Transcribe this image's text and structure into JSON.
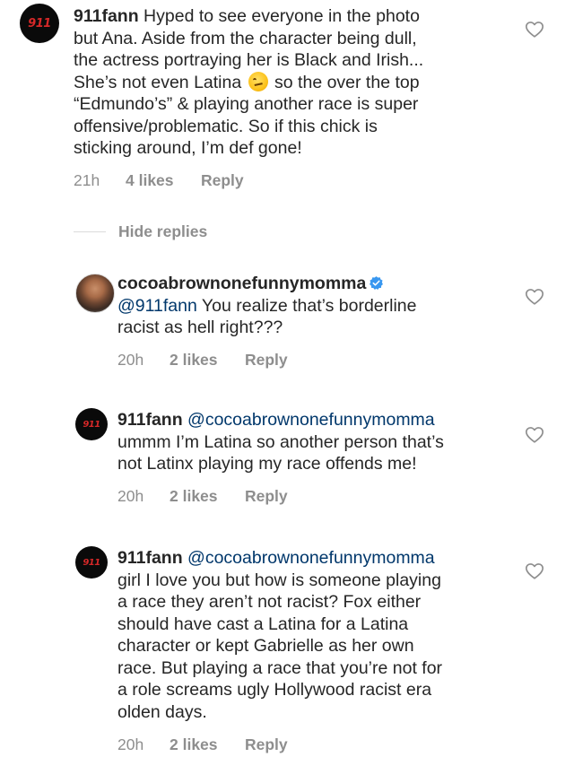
{
  "comments": [
    {
      "avatar_text": "911",
      "username": "911fann",
      "lines": [
        "Hyped to see everyone in the photo",
        "but Ana. Aside from the character being dull,",
        "the actress portraying her is Black and Irish...",
        "She’s not even Latina",
        "so the over the top",
        "“Edmundo’s” & playing another race is super",
        "offensive/problematic. So if this chick is",
        "sticking around, I’m def gone!"
      ],
      "emoji": "smirking-face-emoji",
      "time": "21h",
      "likes": "4 likes",
      "reply": "Reply"
    },
    {
      "username": "cocoabrownonefunnymomma",
      "verified": true,
      "mention": "@911fann",
      "lines": [
        "You realize that’s borderline",
        "racist as hell right???"
      ],
      "time": "20h",
      "likes": "2 likes",
      "reply": "Reply"
    },
    {
      "avatar_text": "911",
      "username": "911fann",
      "mention": "@cocoabrownonefunnymomma",
      "lines": [
        "ummm I’m Latina so another person that’s",
        "not Latinx playing my race offends me!"
      ],
      "time": "20h",
      "likes": "2 likes",
      "reply": "Reply"
    },
    {
      "avatar_text": "911",
      "username": "911fann",
      "mention": "@cocoabrownonefunnymomma",
      "lines": [
        "girl I love you but how is someone playing",
        "a race they aren’t not racist? Fox either",
        "should have cast a Latina for a Latina",
        "character or kept Gabrielle as her own",
        "race. But playing a race that you’re not for",
        "a role screams ugly Hollywood racist era",
        "olden days."
      ],
      "time": "20h",
      "likes": "2 likes",
      "reply": "Reply"
    }
  ],
  "hide_replies_label": "Hide replies",
  "icons": {
    "like": "heart-outline-icon",
    "verified": "verified-badge-icon"
  },
  "colors": {
    "text": "#262626",
    "meta": "#8e8e8e",
    "mention": "#00376b",
    "verified": "#3897f0",
    "avatar_911_bg": "#0a0a0a",
    "avatar_911_text": "#d62828"
  }
}
